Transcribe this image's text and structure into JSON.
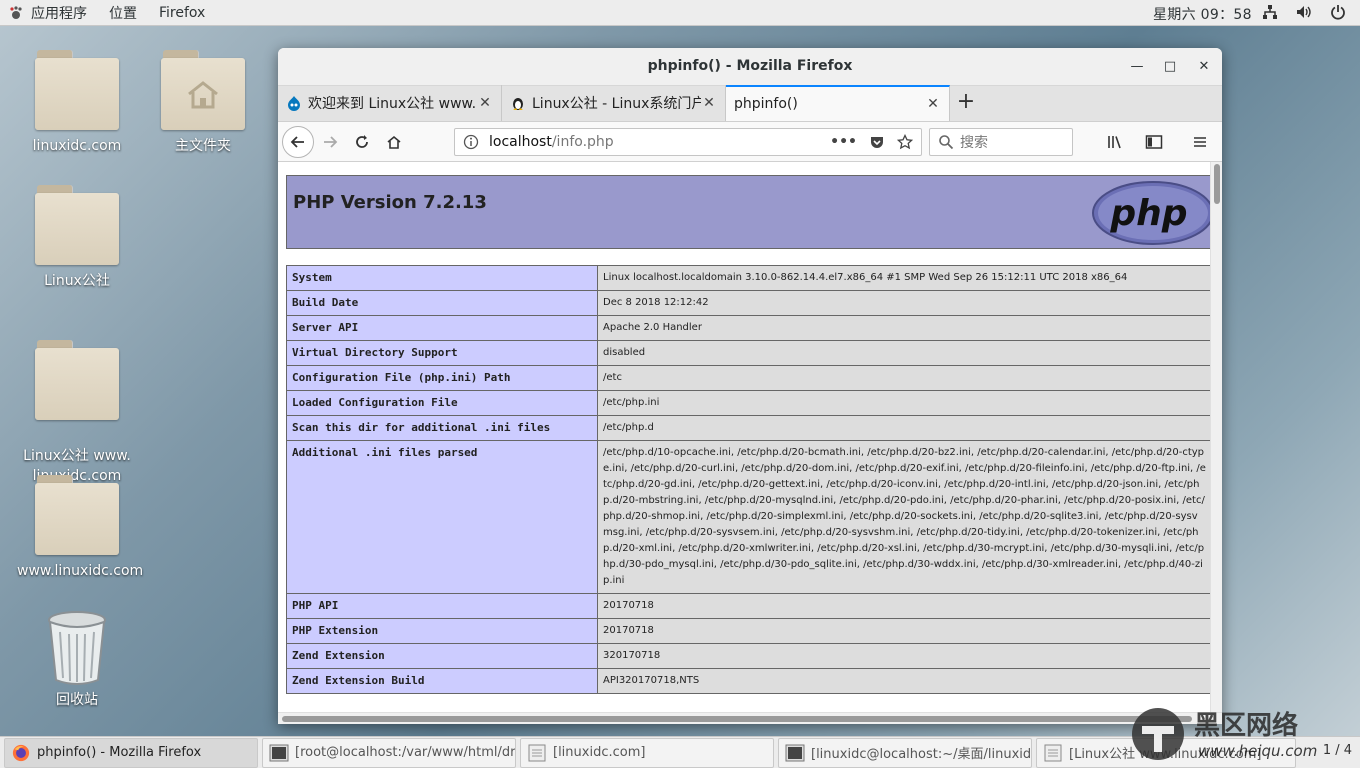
{
  "top_panel": {
    "applications": "应用程序",
    "places": "位置",
    "active_app": "Firefox",
    "clock": "星期六 09：58"
  },
  "desktop_icons": [
    {
      "label": "linuxidc.com"
    },
    {
      "label": "主文件夹"
    },
    {
      "label": "Linux公社"
    },
    {
      "label": "Linux公社 www.\nlinuxidc.com"
    },
    {
      "label": "www.linuxidc.com"
    },
    {
      "label": "回收站"
    }
  ],
  "window": {
    "title": "phpinfo() - Mozilla Firefox",
    "tabs": [
      {
        "label": "欢迎来到 Linux公社 www.",
        "icon": "drupal-icon"
      },
      {
        "label": "Linux公社 - Linux系统门户",
        "icon": "tux-icon"
      },
      {
        "label": "phpinfo()",
        "icon": ""
      }
    ],
    "url_host": "localhost",
    "url_path": "/info.php",
    "search_placeholder": "搜索"
  },
  "php": {
    "version_title": "PHP Version 7.2.13",
    "logo_text": "php",
    "rows": [
      {
        "key": "System",
        "value": "Linux localhost.localdomain 3.10.0-862.14.4.el7.x86_64 #1 SMP Wed Sep 26 15:12:11 UTC 2018 x86_64"
      },
      {
        "key": "Build Date",
        "value": "Dec 8 2018 12:12:42"
      },
      {
        "key": "Server API",
        "value": "Apache 2.0 Handler"
      },
      {
        "key": "Virtual Directory Support",
        "value": "disabled"
      },
      {
        "key": "Configuration File (php.ini) Path",
        "value": "/etc"
      },
      {
        "key": "Loaded Configuration File",
        "value": "/etc/php.ini"
      },
      {
        "key": "Scan this dir for additional .ini files",
        "value": "/etc/php.d"
      },
      {
        "key": "Additional .ini files parsed",
        "value": "/etc/php.d/10-opcache.ini, /etc/php.d/20-bcmath.ini, /etc/php.d/20-bz2.ini, /etc/php.d/20-calendar.ini, /etc/php.d/20-ctype.ini, /etc/php.d/20-curl.ini, /etc/php.d/20-dom.ini, /etc/php.d/20-exif.ini, /etc/php.d/20-fileinfo.ini, /etc/php.d/20-ftp.ini, /etc/php.d/20-gd.ini, /etc/php.d/20-gettext.ini, /etc/php.d/20-iconv.ini, /etc/php.d/20-intl.ini, /etc/php.d/20-json.ini, /etc/php.d/20-mbstring.ini, /etc/php.d/20-mysqlnd.ini, /etc/php.d/20-pdo.ini, /etc/php.d/20-phar.ini, /etc/php.d/20-posix.ini, /etc/php.d/20-shmop.ini, /etc/php.d/20-simplexml.ini, /etc/php.d/20-sockets.ini, /etc/php.d/20-sqlite3.ini, /etc/php.d/20-sysvmsg.ini, /etc/php.d/20-sysvsem.ini, /etc/php.d/20-sysvshm.ini, /etc/php.d/20-tidy.ini, /etc/php.d/20-tokenizer.ini, /etc/php.d/20-xml.ini, /etc/php.d/20-xmlwriter.ini, /etc/php.d/20-xsl.ini, /etc/php.d/30-mcrypt.ini, /etc/php.d/30-mysqli.ini, /etc/php.d/30-pdo_mysql.ini, /etc/php.d/30-pdo_sqlite.ini, /etc/php.d/30-wddx.ini, /etc/php.d/30-xmlreader.ini, /etc/php.d/40-zip.ini"
      },
      {
        "key": "PHP API",
        "value": "20170718"
      },
      {
        "key": "PHP Extension",
        "value": "20170718"
      },
      {
        "key": "Zend Extension",
        "value": "320170718"
      },
      {
        "key": "Zend Extension Build",
        "value": "API320170718,NTS"
      }
    ]
  },
  "taskbar": {
    "items": [
      {
        "label": "phpinfo() - Mozilla Firefox"
      },
      {
        "label": "[root@localhost:/var/www/html/dr…"
      },
      {
        "label": "[linuxidc.com]"
      },
      {
        "label": "[linuxidc@localhost:~/桌面/linuxidc-…"
      },
      {
        "label": "[Linux公社 www.linuxidc.com]"
      }
    ],
    "pager": "1 / 4"
  },
  "watermark": {
    "brand": "黑区网络",
    "url": "www.heiqu.com"
  },
  "colors": {
    "php_header": "#9999cc",
    "php_key_cell": "#ccccff",
    "php_value_cell": "#dddddd",
    "active_tab_accent": "#0a84ff"
  }
}
